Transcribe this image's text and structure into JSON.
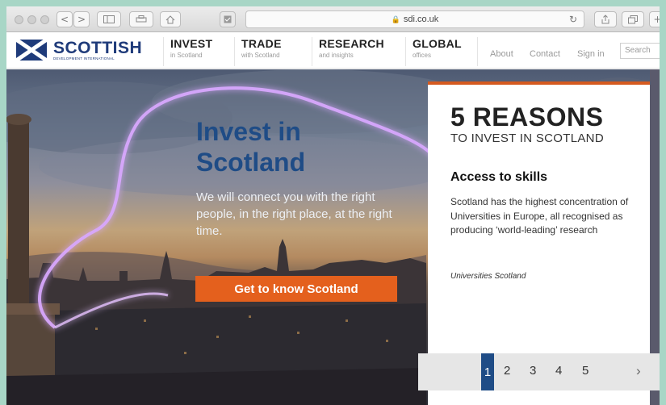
{
  "browser": {
    "url": "sdi.co.uk",
    "back": "<",
    "forward": ">",
    "reload": "↻"
  },
  "header": {
    "logo_text": "SCOTTISH",
    "logo_subtext": "DEVELOPMENT INTERNATIONAL",
    "nav": [
      {
        "title": "INVEST",
        "sub": "in Scotland"
      },
      {
        "title": "TRADE",
        "sub": "with Scotland"
      },
      {
        "title": "RESEARCH",
        "sub": "and insights"
      },
      {
        "title": "GLOBAL",
        "sub": "offices"
      }
    ],
    "util": {
      "about": "About",
      "contact": "Contact",
      "signin": "Sign in",
      "search": "Search"
    }
  },
  "hero": {
    "title_line1": "Invest in",
    "title_line2": "Scotland",
    "text": "We will connect you with the right people, in the right place, at the right time.",
    "cta": "Get to know Scotland"
  },
  "panel": {
    "headline": "5 REASONS",
    "subheadline": "TO INVEST IN SCOTLAND",
    "reason_title": "Access to skills",
    "reason_body": "Scotland has the highest concentration of Universities in Europe, all recognised as producing ‘world-leading’ research",
    "source": "Universities Scotland",
    "pages": [
      "1",
      "2",
      "3",
      "4",
      "5"
    ],
    "active_page": "1",
    "next": "›"
  },
  "colors": {
    "brand_blue": "#1f4c86",
    "accent_orange": "#e4601d",
    "background_teal": "#a8d6c6"
  }
}
